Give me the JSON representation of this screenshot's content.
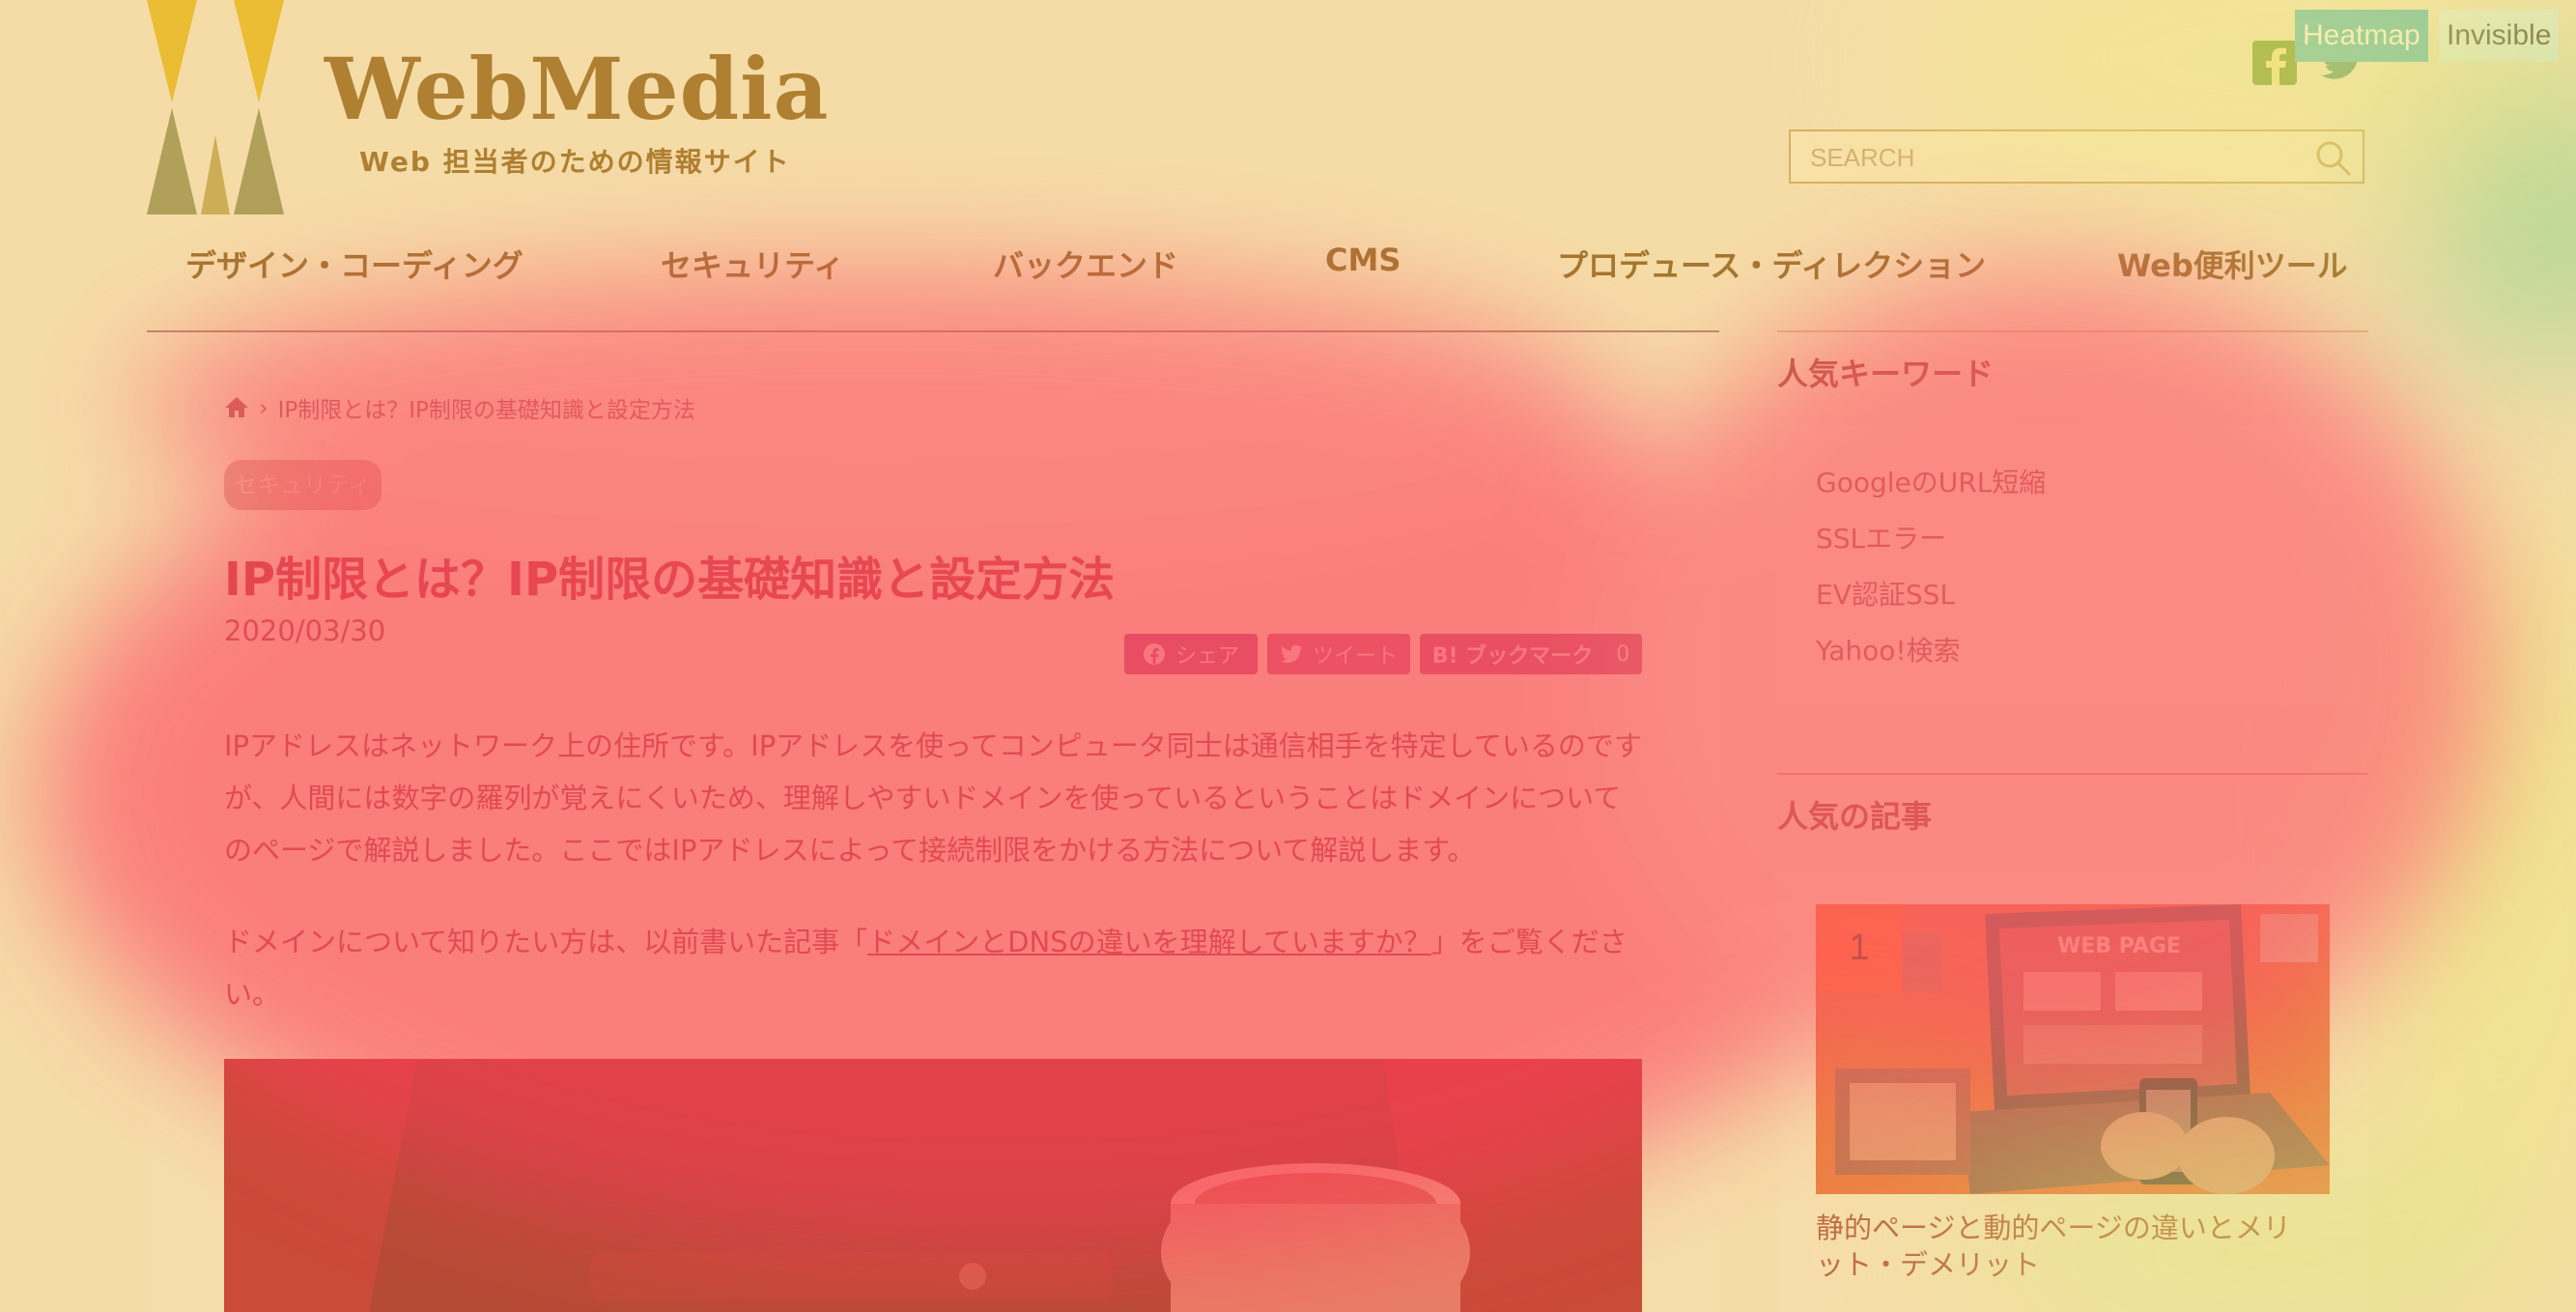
{
  "header": {
    "logo_text": "WebMedia",
    "tagline": "Web 担当者のための情報サイト",
    "heatmap_button": "Heatmap",
    "invisible_button": "Invisible",
    "search_placeholder": "SEARCH",
    "social": [
      "facebook-icon",
      "twitter-icon"
    ]
  },
  "nav": {
    "items": [
      "デザイン・コーディング",
      "セキュリティ",
      "バックエンド",
      "CMS",
      "プロデュース・ディレクション",
      "Web便利ツール"
    ]
  },
  "article": {
    "breadcrumb": "IP制限とは？IP制限の基礎知識と設定方法",
    "category": "セキュリティ",
    "title": "IP制限とは？IP制限の基礎知識と設定方法",
    "date": "2020/03/30",
    "share": {
      "facebook": "シェア",
      "twitter": "ツイート",
      "hatena": "B! ブックマーク",
      "hatena_count": "0"
    },
    "para1": "IPアドレスはネットワーク上の住所です。IPアドレスを使ってコンピュータ同士は通信相手を特定しているのですが、人間には数字の羅列が覚えにくいため、理解しやすいドメインを使っているということはドメインについてのページで解説しました。ここではIPアドレスによって接続制限をかける方法について解説します。",
    "para2_before": "ドメインについて知りたい方は、以前書いた記事「",
    "para2_link": "ドメインとDNSの違いを理解していますか？",
    "para2_after": "」をご覧ください。"
  },
  "sidebar": {
    "keywords_heading": "人気キーワード",
    "keywords": [
      "GoogleのURL短縮",
      "SSLエラー",
      "EV認証SSL",
      "Yahoo!検索"
    ],
    "popular_heading": "人気の記事",
    "popular": [
      {
        "rank": "1",
        "image_text": "WEB PAGE",
        "title": "静的ページと動的ページの違いとメリット・デメリット"
      }
    ]
  },
  "colors": {
    "brand": "#8a5a14",
    "accent": "#b3162c",
    "rank_badge": "#ff5a17",
    "heatmap_button": "#3fb6c2"
  }
}
